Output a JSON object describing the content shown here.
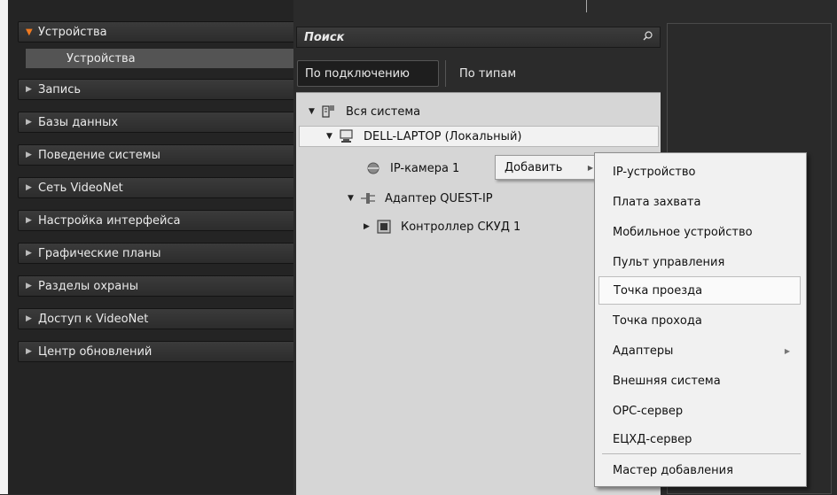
{
  "sidebar": {
    "items": [
      {
        "label": "Устройства",
        "expanded": true
      },
      {
        "label": "Запись",
        "expanded": false
      },
      {
        "label": "Базы данных",
        "expanded": false
      },
      {
        "label": "Поведение системы",
        "expanded": false
      },
      {
        "label": "Сеть VideoNet",
        "expanded": false
      },
      {
        "label": "Настройка интерфейса",
        "expanded": false
      },
      {
        "label": "Графические планы",
        "expanded": false
      },
      {
        "label": "Разделы охраны",
        "expanded": false
      },
      {
        "label": "Доступ к VideoNet",
        "expanded": false
      },
      {
        "label": "Центр обновлений",
        "expanded": false
      }
    ],
    "subitem": "Устройства"
  },
  "search": {
    "label": "Поиск"
  },
  "tabs": [
    {
      "label": "По подключению",
      "active": true
    },
    {
      "label": "По типам",
      "active": false
    }
  ],
  "tree": [
    {
      "label": "Вся система",
      "icon": "system-icon",
      "expander": "▼"
    },
    {
      "label": "DELL-LAPTOP (Локальный)",
      "icon": "computer-icon",
      "expander": "▼",
      "selected": true
    },
    {
      "label": "IP-камера 1",
      "icon": "camera-icon",
      "expander": ""
    },
    {
      "label": "Адаптер QUEST-IP",
      "icon": "adapter-icon",
      "expander": "▼"
    },
    {
      "label": "Контроллер СКУД 1",
      "icon": "controller-icon",
      "expander": "▶"
    }
  ],
  "context_menu": {
    "add_label": "Добавить"
  },
  "submenu": {
    "items": [
      {
        "label": "IP-устройство"
      },
      {
        "label": "Плата захвата"
      },
      {
        "label": "Мобильное устройство"
      },
      {
        "label": "Пульт управления"
      },
      {
        "label": "Точка проезда",
        "highlighted": true
      },
      {
        "label": "Точка прохода"
      },
      {
        "label": "Адаптеры",
        "has_submenu": true
      },
      {
        "label": "Внешняя система"
      },
      {
        "label": "OPC-сервер"
      },
      {
        "label": "ЕЦХД-сервер"
      },
      {
        "label": "Мастер добавления"
      }
    ]
  },
  "colors": {
    "accent": "#f07a20",
    "sidebar_bg": "#242424",
    "tree_bg": "#d6d6d6",
    "menu_bg": "#f1f1f1"
  }
}
